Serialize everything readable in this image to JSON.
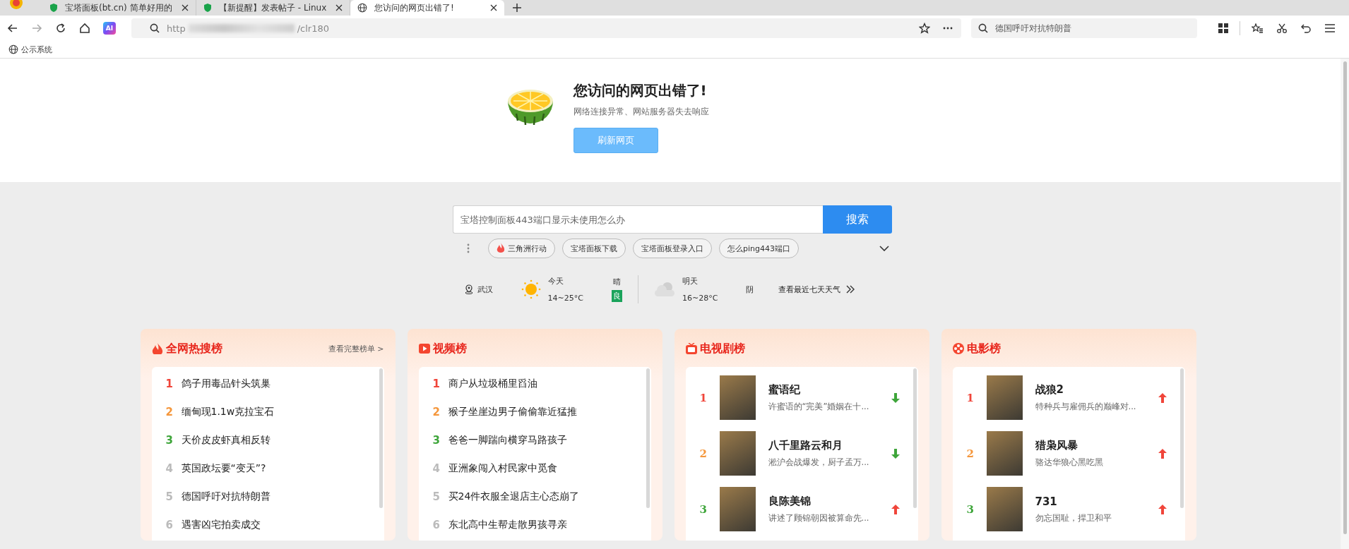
{
  "browser": {
    "tabs": [
      {
        "title": "宝塔面板(bt.cn) 简单好用的",
        "selected": false
      },
      {
        "title": "【新提醒】发表帖子 - Linux",
        "selected": false
      },
      {
        "title": "您访问的网页出错了!",
        "selected": true
      }
    ],
    "ai_label": "AI",
    "address": {
      "start": "http",
      "end": "/clr180"
    },
    "search_box": {
      "value": "德国呼吁对抗特朗普"
    },
    "bookmarks": [
      {
        "label": "公示系统"
      }
    ]
  },
  "error": {
    "title": "您访问的网页出错了!",
    "message": "网络连接异常、网站服务器失去响应",
    "button": "刷新网页"
  },
  "search": {
    "placeholder": "宝塔控制面板443端口显示未使用怎么办",
    "button": "搜索",
    "chips": [
      {
        "label": "三角洲行动",
        "hot": true
      },
      {
        "label": "宝塔面板下载",
        "hot": false
      },
      {
        "label": "宝塔面板登录入口",
        "hot": false
      },
      {
        "label": "怎么ping443端口",
        "hot": false
      }
    ]
  },
  "weather": {
    "city": "武汉",
    "today": {
      "label": "今天",
      "temp": "14~25°C",
      "condition": "晴",
      "air": "良"
    },
    "tomorrow": {
      "label": "明天",
      "temp": "16~28°C",
      "condition": "阴"
    },
    "link": "查看最近七天天气"
  },
  "panels": [
    {
      "kind": "list",
      "title": "全网热搜榜",
      "more": "查看完整榜单 >",
      "items": [
        {
          "rank": "1",
          "text": "鸽子用毒品针头筑巢"
        },
        {
          "rank": "2",
          "text": "缅甸现1.1w克拉宝石"
        },
        {
          "rank": "3",
          "text": "天价皮皮虾真相反转"
        },
        {
          "rank": "4",
          "text": "英国政坛要“变天”?"
        },
        {
          "rank": "5",
          "text": "德国呼吁对抗特朗普"
        },
        {
          "rank": "6",
          "text": "遇害凶宅拍卖成交"
        }
      ]
    },
    {
      "kind": "list",
      "title": "视频榜",
      "items": [
        {
          "rank": "1",
          "text": "商户从垃圾桶里舀油"
        },
        {
          "rank": "2",
          "text": "猴子坐崖边男子偷偷靠近猛推"
        },
        {
          "rank": "3",
          "text": "爸爸一脚踹向横穿马路孩子"
        },
        {
          "rank": "4",
          "text": "亚洲象闯入村民家中觅食"
        },
        {
          "rank": "5",
          "text": "买24件衣服全退店主心态崩了"
        },
        {
          "rank": "6",
          "text": "东北高中生帮走散男孩寻亲"
        }
      ]
    },
    {
      "kind": "media",
      "title": "电视剧榜",
      "items": [
        {
          "rank": "1",
          "text": "蜜语纪",
          "desc": "许蜜语的“完美”婚姻在十...",
          "rising": false
        },
        {
          "rank": "2",
          "text": "八千里路云和月",
          "desc": "淞沪会战爆发，厨子孟万...",
          "rising": false
        },
        {
          "rank": "3",
          "text": "良陈美锦",
          "desc": "讲述了顾锦朝因被算命先...",
          "rising": true
        }
      ]
    },
    {
      "kind": "media",
      "title": "电影榜",
      "items": [
        {
          "rank": "1",
          "text": "战狼2",
          "desc": "特种兵与雇佣兵的巅峰对...",
          "rising": true
        },
        {
          "rank": "2",
          "text": "猎枭风暴",
          "desc": "骆达华狼心黑吃黑",
          "rising": true
        },
        {
          "rank": "3",
          "text": "731",
          "desc": "勿忘国耻，捍卫和平",
          "rising": true
        }
      ]
    }
  ]
}
